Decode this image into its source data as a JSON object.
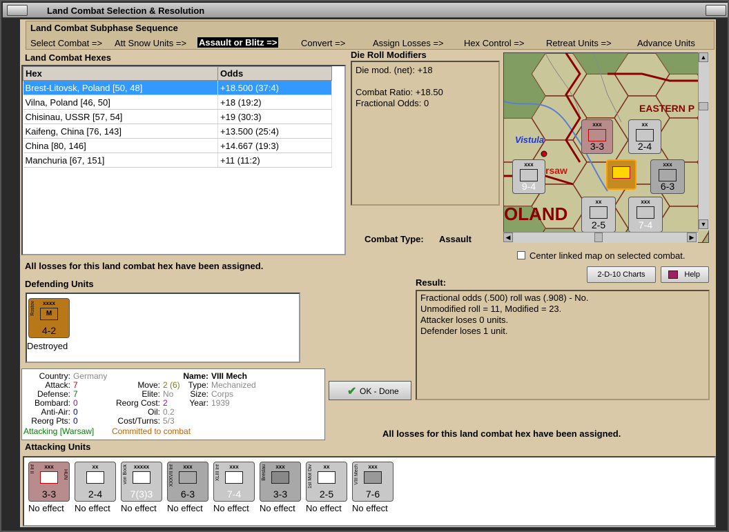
{
  "window": {
    "title": "Land Combat Selection & Resolution"
  },
  "subphase": {
    "header": "Land Combat Subphase Sequence",
    "steps": [
      "Select Combat =>",
      "Att Snow Units =>",
      "Assault or Blitz =>",
      "Convert =>",
      "Assign Losses =>",
      "Hex Control =>",
      "Retreat Units =>",
      "Advance Units"
    ],
    "active_index": 2
  },
  "hexes": {
    "header": "Land Combat Hexes",
    "columns": [
      "Hex",
      "Odds"
    ],
    "rows": [
      {
        "hex": "Brest-Litovsk, Poland [50, 48]",
        "odds": "+18.500 (37:4)"
      },
      {
        "hex": "Vilna, Poland [46, 50]",
        "odds": "+18 (19:2)"
      },
      {
        "hex": "Chisinau, USSR [57, 54]",
        "odds": "+19 (30:3)"
      },
      {
        "hex": "Kaifeng, China [76, 143]",
        "odds": "+13.500 (25:4)"
      },
      {
        "hex": "China [80, 146]",
        "odds": "+14.667 (19:3)"
      },
      {
        "hex": "Manchuria [67, 151]",
        "odds": "+11 (11:2)"
      }
    ]
  },
  "die_mods": {
    "header": "Die Roll Modifiers",
    "line1": "Die mod. (net): +18",
    "line2": "Combat Ratio: +18.50",
    "line3": "Fractional Odds: 0"
  },
  "map": {
    "labels": {
      "vistula": "Vistula",
      "warsaw": "rsaw",
      "eastern": "EASTERN P",
      "poland": "OLAND"
    },
    "units": [
      {
        "size": "xxx",
        "strength": "3-3",
        "tag": "II Inf",
        "stack": "2"
      },
      {
        "size": "xx",
        "strength": "2-4",
        "tag": "",
        "stack": "2"
      },
      {
        "size": "xxx",
        "strength": "9-4",
        "tag": "Inf",
        "stack": ""
      },
      {
        "size": "xxx",
        "strength": "6-3",
        "tag": "XXXVII",
        "stack": "2"
      },
      {
        "size": "xx",
        "strength": "2-5",
        "tag": "1st Mot Div",
        "stack": "2"
      },
      {
        "size": "xxx",
        "strength": "7-4",
        "tag": "XIII Inf",
        "stack": ""
      }
    ],
    "center_checkbox_label": "Center linked map on selected combat."
  },
  "combat_type": {
    "label": "Combat Type:",
    "value": "Assault"
  },
  "losses_msg_top": "All losses for this land combat hex have been assigned.",
  "losses_msg_bottom": "All losses for this land combat hex have been assigned.",
  "defending": {
    "header": "Defending Units",
    "units": [
      {
        "size": "xxxx",
        "strength": "4-2",
        "tag": "Rostov",
        "symbol": "M",
        "status": "Destroyed"
      }
    ]
  },
  "buttons": {
    "charts": "2-D-10 Charts",
    "help": "Help",
    "ok": "OK - Done"
  },
  "result": {
    "header": "Result:",
    "lines": [
      "Fractional odds (.500) roll was (.908)  - No.",
      "Unmodified roll = 11, Modified = 23.",
      "Attacker loses 0 units.",
      "Defender loses 1 unit."
    ]
  },
  "info": {
    "country_label": "Country:",
    "country": "Germany",
    "attack_label": "Attack:",
    "attack": "7",
    "defense_label": "Defense:",
    "defense": "7",
    "bombard_label": "Bombard:",
    "bombard": "0",
    "antiair_label": "Anti-Air:",
    "antiair": "0",
    "reorgpts_label": "Reorg Pts:",
    "reorgpts": "0",
    "move_label": "Move:",
    "move": "2 (6)",
    "elite_label": "Elite:",
    "elite": "No",
    "reorgcost_label": "Reorg Cost:",
    "reorgcost": "2",
    "oil_label": "Oil:",
    "oil": "0.2",
    "costturns_label": "Cost/Turns:",
    "costturns": "5/3",
    "name_label": "Name:",
    "name": "VIII Mech",
    "type_label": "Type:",
    "type": "Mechanized",
    "size_label": "Size:",
    "size": "Corps",
    "year_label": "Year:",
    "year": "1939",
    "attacking_from": "Attacking [Warsaw]",
    "committed": "Committed to combat"
  },
  "attacking": {
    "header": "Attacking Units",
    "units": [
      {
        "size": "xxx",
        "strength": "3-3",
        "tag": "II Inf",
        "natl": "HUN",
        "status": "No effect"
      },
      {
        "size": "xx",
        "strength": "2-4",
        "tag": "",
        "natl": "",
        "status": "No effect"
      },
      {
        "size": "xxxxx",
        "strength": "7(3)3",
        "tag": "von Bock",
        "natl": "",
        "status": "No effect"
      },
      {
        "size": "xxx",
        "strength": "6-3",
        "tag": "XXXVII Inf",
        "natl": "",
        "status": "No effect"
      },
      {
        "size": "xxx",
        "strength": "7-4",
        "tag": "XLIII Inf",
        "natl": "",
        "status": "No effect"
      },
      {
        "size": "xxx",
        "strength": "3-3",
        "tag": "Breslau",
        "natl": "",
        "status": "No effect"
      },
      {
        "size": "xx",
        "strength": "2-5",
        "tag": "1st Mot Div",
        "natl": "",
        "status": "No effect"
      },
      {
        "size": "xxx",
        "strength": "7-6",
        "tag": "VIII Mech",
        "natl": "",
        "status": "No effect"
      }
    ]
  },
  "colors": {
    "attack_red": "#c00000",
    "defense_green": "#008000",
    "bombard_magenta": "#b000b0",
    "antiair_blue": "#0000c0",
    "attacking_green": "#008000",
    "committed_orange": "#c06000",
    "selection": "#3399ff"
  }
}
